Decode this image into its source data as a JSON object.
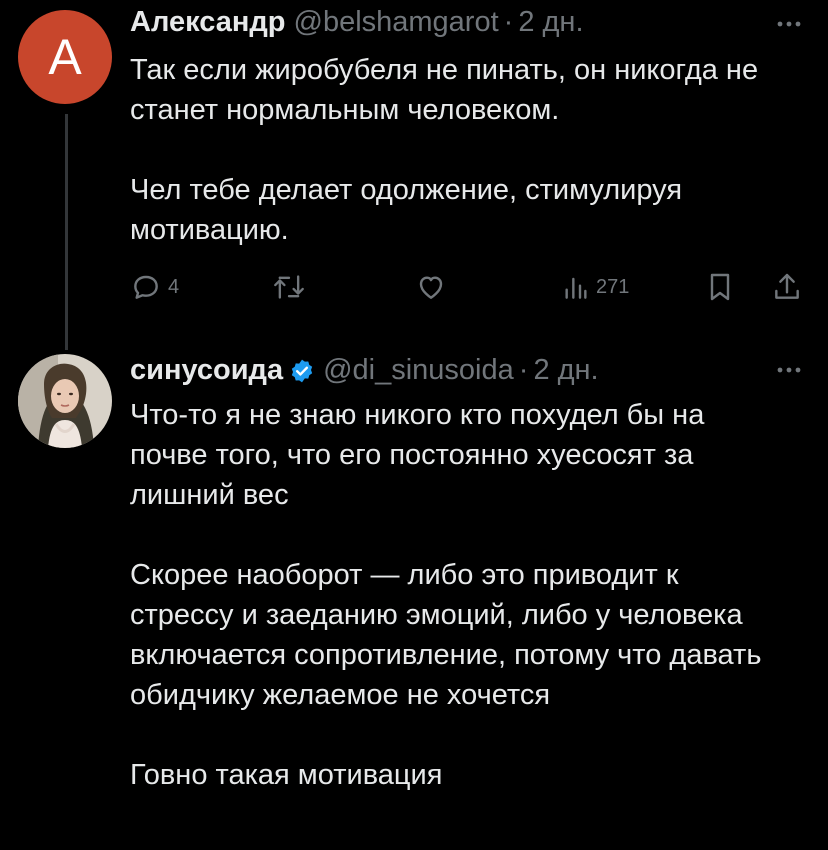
{
  "tweets": [
    {
      "avatar_letter": "A",
      "name": "Александр",
      "handle": "@belshamgarot",
      "separator": "·",
      "time": "2 дн.",
      "paragraphs": [
        "Так если жиробубеля не пинать, он никогда не станет нормальным человеком.",
        "Чел тебе делает одолжение, стимулируя мотивацию."
      ],
      "actions": {
        "replies": "4",
        "retweets": "",
        "likes": "",
        "views": "271"
      }
    },
    {
      "name": "синусоида",
      "verified": true,
      "handle": "@di_sinusoida",
      "separator": "·",
      "time": "2 дн.",
      "paragraphs": [
        "Что-то я не знаю никого кто похудел бы на почве того, что его постоянно хуесосят за лишний вес",
        "Скорее наоборот — либо это приводит к стрессу и заеданию эмоций, либо у человека включается сопротивление, потому что давать обидчику желаемое не хочется",
        "Говно такая мотивация"
      ]
    }
  ],
  "colors": {
    "background": "#000000",
    "text": "#e7e9ea",
    "secondary": "#71767b",
    "verified": "#1d9bf0",
    "avatar_bg": "#c8462c",
    "thread_line": "#333639"
  },
  "icons": [
    "reply-icon",
    "retweet-icon",
    "like-icon",
    "views-icon",
    "bookmark-icon",
    "share-icon",
    "more-icon",
    "verified-badge-icon"
  ]
}
